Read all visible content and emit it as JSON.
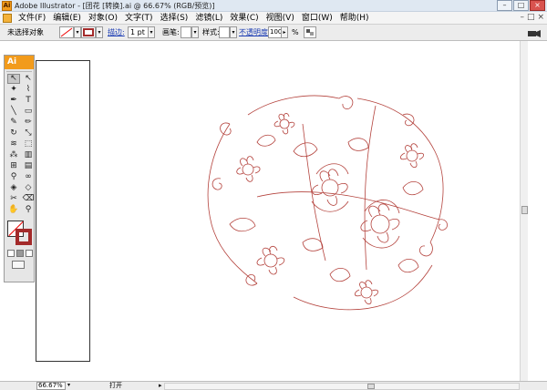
{
  "window": {
    "title": "Adobe Illustrator - [团花 [转换].ai @ 66.67% (RGB/预览)]",
    "app_icon_label": "Ai",
    "controls": [
      "–",
      "□",
      "×"
    ]
  },
  "menubar": {
    "items": [
      "文件(F)",
      "编辑(E)",
      "对象(O)",
      "文字(T)",
      "选择(S)",
      "滤镜(L)",
      "效果(C)",
      "视图(V)",
      "窗口(W)",
      "帮助(H)"
    ],
    "doc_controls": [
      "–",
      "□",
      "×"
    ]
  },
  "control_bar": {
    "selection_status": "未选择对象",
    "stroke_label": "描边:",
    "stroke_weight": "1 pt",
    "brush_label": "画笔:",
    "style_label": "样式:",
    "opacity_label": "不透明度:",
    "opacity_value": "100",
    "opacity_unit": "%",
    "colors": {
      "stroke": "#a32a2a",
      "link": "#1a3bb3"
    }
  },
  "toolbox": {
    "header": "Ai",
    "tools": [
      {
        "name": "selection-tool",
        "glyph": "↖",
        "active": true
      },
      {
        "name": "direct-selection-tool",
        "glyph": "↖"
      },
      {
        "name": "magic-wand-tool",
        "glyph": "✦"
      },
      {
        "name": "lasso-tool",
        "glyph": "⌇"
      },
      {
        "name": "pen-tool",
        "glyph": "✒"
      },
      {
        "name": "type-tool",
        "glyph": "T"
      },
      {
        "name": "line-tool",
        "glyph": "╲"
      },
      {
        "name": "rectangle-tool",
        "glyph": "▭"
      },
      {
        "name": "paintbrush-tool",
        "glyph": "✎"
      },
      {
        "name": "pencil-tool",
        "glyph": "✏"
      },
      {
        "name": "rotate-tool",
        "glyph": "↻"
      },
      {
        "name": "scale-tool",
        "glyph": "⤡"
      },
      {
        "name": "warp-tool",
        "glyph": "≋"
      },
      {
        "name": "free-transform-tool",
        "glyph": "⬚"
      },
      {
        "name": "symbol-sprayer-tool",
        "glyph": "⁂"
      },
      {
        "name": "column-graph-tool",
        "glyph": "▥"
      },
      {
        "name": "mesh-tool",
        "glyph": "⊞"
      },
      {
        "name": "gradient-tool",
        "glyph": "▤"
      },
      {
        "name": "eyedropper-tool",
        "glyph": "⚲"
      },
      {
        "name": "blend-tool",
        "glyph": "∞"
      },
      {
        "name": "live-paint-bucket-tool",
        "glyph": "◈"
      },
      {
        "name": "live-paint-selection-tool",
        "glyph": "◇"
      },
      {
        "name": "slice-tool",
        "glyph": "✂"
      },
      {
        "name": "eraser-tool",
        "glyph": "⌫"
      },
      {
        "name": "hand-tool",
        "glyph": "✋"
      },
      {
        "name": "zoom-tool",
        "glyph": "⚲"
      }
    ]
  },
  "statusbar": {
    "zoom": "66.67%",
    "state": "打开"
  },
  "artwork": {
    "description_color": "#b4433d"
  }
}
